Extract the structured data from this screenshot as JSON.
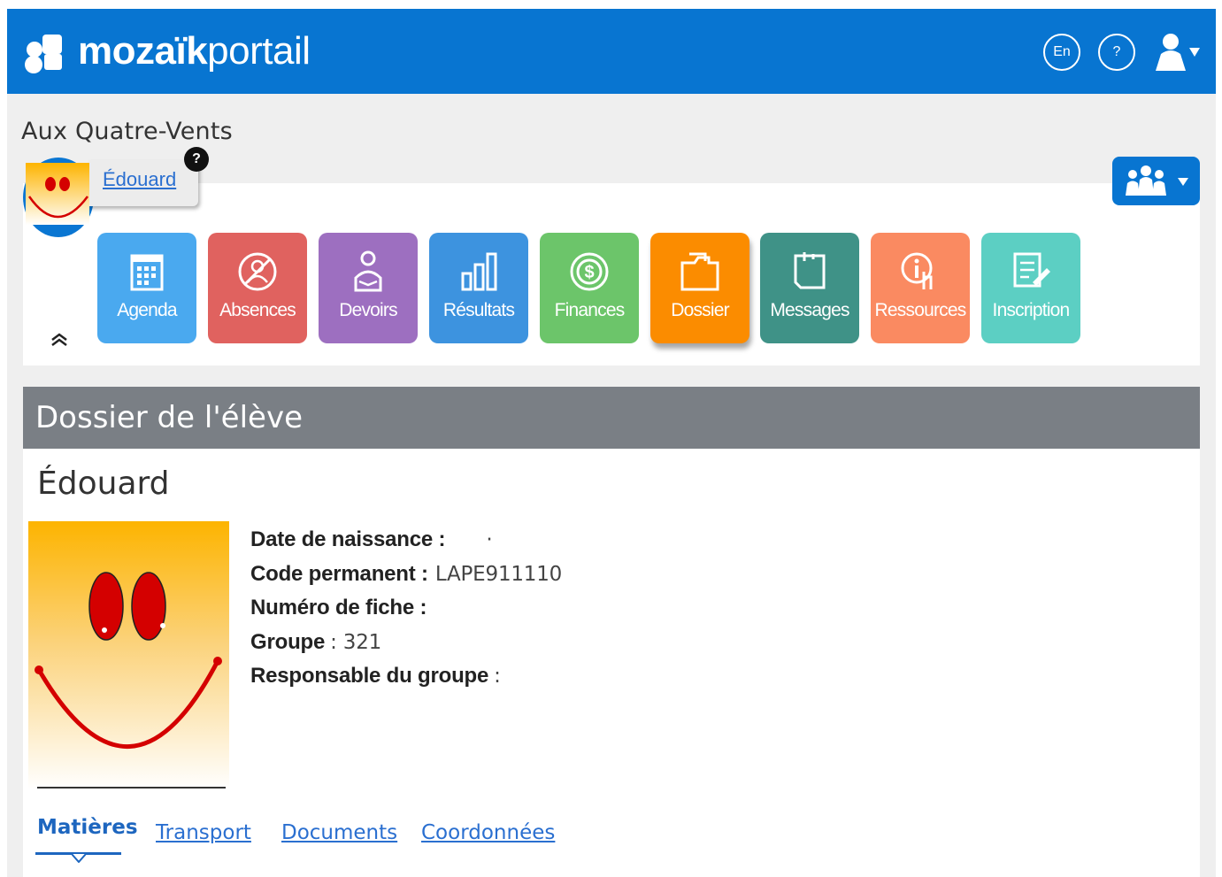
{
  "header": {
    "brand_bold": "mozaïk",
    "brand_light": "portail",
    "lang_label": "En",
    "help_label": "?",
    "brand_color": "#0875d1"
  },
  "school": {
    "name": "Aux Quatre-Vents"
  },
  "student_selector": {
    "name": "Édouard",
    "help_badge": "?"
  },
  "nav": {
    "tiles": [
      {
        "label": "Agenda",
        "icon": "calendar-icon",
        "color": "#4aa9ef"
      },
      {
        "label": "Absences",
        "icon": "absences-icon",
        "color": "#e0625f"
      },
      {
        "label": "Devoirs",
        "icon": "homework-icon",
        "color": "#9d6fc0"
      },
      {
        "label": "Résultats",
        "icon": "results-chart-icon",
        "color": "#3d93df"
      },
      {
        "label": "Finances",
        "icon": "dollar-coin-icon",
        "color": "#6cc56a"
      },
      {
        "label": "Dossier",
        "icon": "folder-icon",
        "color": "#fb8c00",
        "active": true
      },
      {
        "label": "Messages",
        "icon": "messages-icon",
        "color": "#3f9287"
      },
      {
        "label": "Ressources",
        "icon": "resources-icon",
        "color": "#fa8a61"
      },
      {
        "label": "Inscription",
        "icon": "inscription-icon",
        "color": "#5ccfc3"
      }
    ]
  },
  "section": {
    "title": "Dossier de l'élève"
  },
  "student": {
    "name": "Édouard",
    "fields": [
      {
        "label": "Date de naissance :",
        "value": "·"
      },
      {
        "label": "Code permanent :",
        "value": "LAPE911110"
      },
      {
        "label": "Numéro de fiche :",
        "value": ""
      },
      {
        "label": "Groupe",
        "value": ": 321"
      },
      {
        "label": "Responsable du groupe",
        "value": ":"
      }
    ]
  },
  "tabs": {
    "items": [
      {
        "label": "Matières",
        "active": true
      },
      {
        "label": "Transport"
      },
      {
        "label": "Documents"
      },
      {
        "label": "Coordonnées"
      }
    ]
  }
}
